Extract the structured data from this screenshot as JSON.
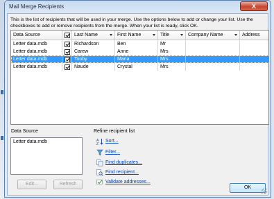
{
  "window": {
    "title": "Mail Merge Recipients",
    "close_label": "X"
  },
  "intro_text": "This is the list of recipients that will be used in your merge.  Use the options below to add or change your list.  Use the checkboxes to add or remove recipients from the merge.  When your list is ready, click OK.",
  "table": {
    "headers": {
      "data_source": "Data Source",
      "last_name": "Last Name",
      "first_name": "First Name",
      "title": "Title",
      "company_name": "Company Name",
      "address": "Address"
    },
    "rows": [
      {
        "data_source": "Letter data.mdb",
        "last_name": "Richardson",
        "first_name": "Ben",
        "title": "Mr",
        "checked": true,
        "selected": false
      },
      {
        "data_source": "Letter data.mdb",
        "last_name": "Carew",
        "first_name": "Anne",
        "title": "Mrs",
        "checked": true,
        "selected": false
      },
      {
        "data_source": "Letter data.mdb",
        "last_name": "Tooby",
        "first_name": "Maria",
        "title": "Mrs",
        "checked": true,
        "selected": true
      },
      {
        "data_source": "Letter data.mdb",
        "last_name": "Naude",
        "first_name": "Crystal",
        "title": "Mrs",
        "checked": true,
        "selected": false
      }
    ]
  },
  "data_source_panel": {
    "label": "Data Source",
    "items": [
      "Letter data.mdb"
    ],
    "edit_label": "Edit...",
    "refresh_label": "Refresh"
  },
  "refine": {
    "label": "Refine recipient list",
    "links": [
      "Sort...",
      "Filter...",
      "Find duplicates...",
      "Find recipient...",
      "Validate addresses..."
    ]
  },
  "ok_label": "OK",
  "colors": {
    "selection": "#3399ff",
    "close_button": "#c7452f",
    "link": "#0645ad"
  }
}
